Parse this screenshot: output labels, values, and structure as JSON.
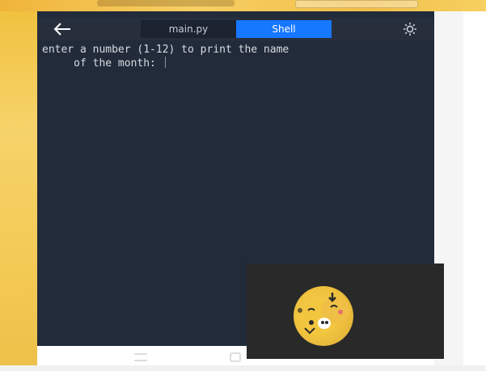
{
  "editor": {
    "back_icon": "arrow-left-icon",
    "tabs": [
      {
        "label": "main.py",
        "active": false
      },
      {
        "label": "Shell",
        "active": true
      }
    ],
    "theme_icon": "sun-icon"
  },
  "shell": {
    "line1": "enter a number (1-12) to print the name",
    "line2": "     of the month: "
  },
  "colors": {
    "background": "#222b3a",
    "active_tab": "#1677ff",
    "text": "#d8dbe2"
  }
}
